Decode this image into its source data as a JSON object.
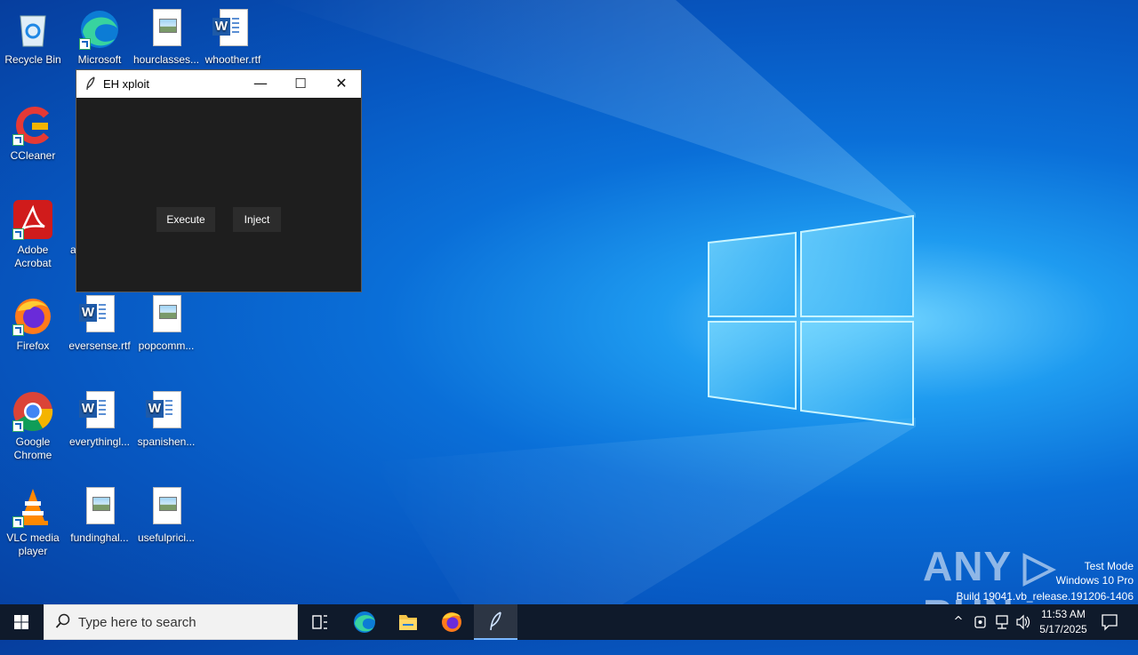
{
  "desktop": {
    "icons": [
      {
        "label": "Recycle Bin"
      },
      {
        "label": "Microsoft Edge"
      },
      {
        "label": "hourclasses..."
      },
      {
        "label": "whoother.rtf"
      },
      {
        "label": "CCleaner"
      },
      {
        "label": "Adobe Acrobat"
      },
      {
        "label": "a"
      },
      {
        "label": "Firefox"
      },
      {
        "label": "eversense.rtf"
      },
      {
        "label": "popcomm..."
      },
      {
        "label": "Google Chrome"
      },
      {
        "label": "everythingl..."
      },
      {
        "label": "spanishen..."
      },
      {
        "label": "VLC media player"
      },
      {
        "label": "fundinghal..."
      },
      {
        "label": "usefulprici..."
      }
    ]
  },
  "window": {
    "title": "EH xploit",
    "minimize": "—",
    "maximize": "☐",
    "close": "✕",
    "buttons": {
      "execute": "Execute",
      "inject": "Inject"
    }
  },
  "watermark": {
    "brand": "ANY ▷ RUN",
    "line1": "Test Mode",
    "line2": "Windows 10 Pro",
    "line3": "Build 19041.vb_release.191206-1406"
  },
  "taskbar": {
    "search_placeholder": "Type here to search",
    "time": "11:53 AM",
    "date": "5/17/2025",
    "tray_up": "^"
  },
  "colors": {
    "taskbar": "#0f1a2b",
    "window_body": "#1e1e1e",
    "button_bg": "#2c2c2c",
    "desktop_blue": "#0a6fd8"
  }
}
